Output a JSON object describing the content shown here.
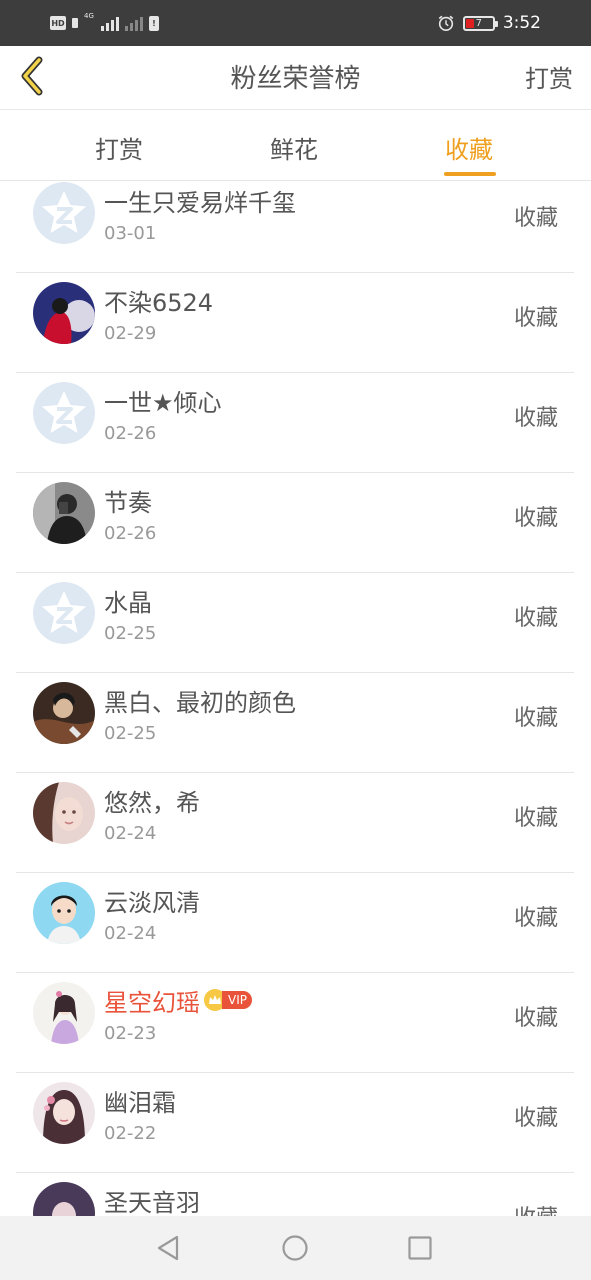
{
  "status_bar": {
    "hd_label": "HD",
    "network_label": "4G",
    "sim_label": "!",
    "battery_level": "7",
    "time": "3:52"
  },
  "header": {
    "title": "粉丝荣誉榜",
    "right_action": "打赏"
  },
  "tabs": [
    {
      "label": "打赏",
      "active": false
    },
    {
      "label": "鲜花",
      "active": false
    },
    {
      "label": "收藏",
      "active": true
    }
  ],
  "colors": {
    "accent": "#f0a020",
    "vip": "#e8533a",
    "status_bar_bg": "#3d3d3d"
  },
  "list": [
    {
      "name": "一生只爱易烊千玺",
      "date": "03-01",
      "action": "收藏",
      "avatar": "default-qq-avatar"
    },
    {
      "name": "不染6524",
      "date": "02-29",
      "action": "收藏",
      "avatar": "user-photo-avatar"
    },
    {
      "name": "一世★倾心",
      "date": "02-26",
      "action": "收藏",
      "avatar": "default-qq-avatar"
    },
    {
      "name": "节奏",
      "date": "02-26",
      "action": "收藏",
      "avatar": "user-photo-avatar"
    },
    {
      "name": "水晶",
      "date": "02-25",
      "action": "收藏",
      "avatar": "default-qq-avatar"
    },
    {
      "name": "黑白、最初的颜色",
      "date": "02-25",
      "action": "收藏",
      "avatar": "user-photo-avatar"
    },
    {
      "name": "悠然，希",
      "date": "02-24",
      "action": "收藏",
      "avatar": "user-photo-avatar"
    },
    {
      "name": "云淡风清",
      "date": "02-24",
      "action": "收藏",
      "avatar": "cartoon-avatar"
    },
    {
      "name": "星空幻瑶",
      "date": "02-23",
      "action": "收藏",
      "avatar": "user-photo-avatar",
      "vip": true,
      "vip_label": "VIP"
    },
    {
      "name": "幽泪霜",
      "date": "02-22",
      "action": "收藏",
      "avatar": "user-photo-avatar"
    },
    {
      "name": "圣天音羽",
      "date": "",
      "action": "收藏",
      "avatar": "user-photo-avatar"
    }
  ],
  "nav_bar": {
    "back": "back-triangle-icon",
    "home": "home-circle-icon",
    "recents": "recents-square-icon"
  }
}
